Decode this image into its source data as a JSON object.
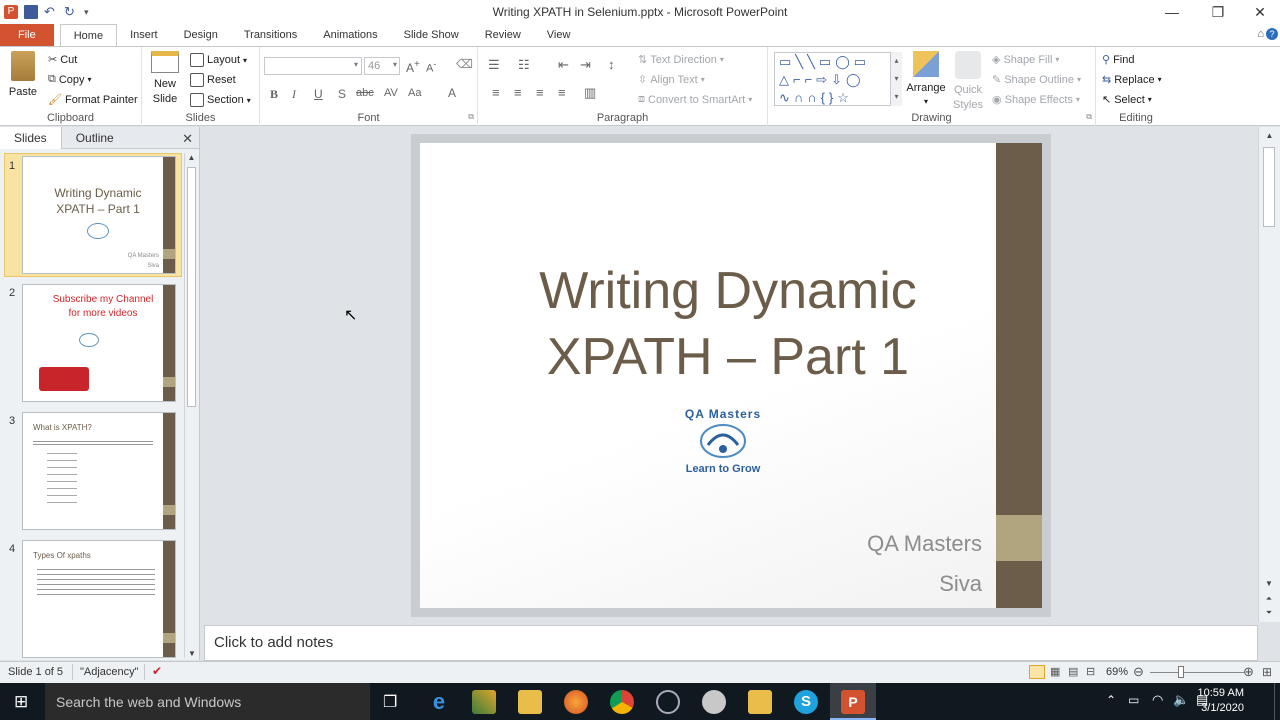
{
  "window": {
    "title": "Writing XPATH in Selenium.pptx - Microsoft PowerPoint",
    "minimize": "—",
    "maximize": "❐",
    "close": "✕"
  },
  "tabs": [
    "File",
    "Home",
    "Insert",
    "Design",
    "Transitions",
    "Animations",
    "Slide Show",
    "Review",
    "View"
  ],
  "ribbon": {
    "clipboard": {
      "label": "Clipboard",
      "paste": "Paste",
      "cut": "Cut",
      "copy": "Copy",
      "format_painter": "Format Painter"
    },
    "slides": {
      "label": "Slides",
      "new_slide_1": "New",
      "new_slide_2": "Slide",
      "layout": "Layout",
      "reset": "Reset",
      "section": "Section"
    },
    "font": {
      "label": "Font",
      "font_name": "",
      "font_size": "46"
    },
    "paragraph": {
      "label": "Paragraph",
      "text_direction": "Text Direction",
      "align_text": "Align Text",
      "convert_smartart": "Convert to SmartArt"
    },
    "drawing": {
      "label": "Drawing",
      "arrange": "Arrange",
      "quick_styles_1": "Quick",
      "quick_styles_2": "Styles",
      "shape_fill": "Shape Fill",
      "shape_outline": "Shape Outline",
      "shape_effects": "Shape Effects"
    },
    "editing": {
      "label": "Editing",
      "find": "Find",
      "replace": "Replace",
      "select": "Select"
    }
  },
  "slides_panel": {
    "tab_slides": "Slides",
    "tab_outline": "Outline",
    "thumbnails": [
      {
        "num": "1",
        "title": "Writing Dynamic XPATH – Part 1",
        "footer1": "QA Masters",
        "footer2": "Siva"
      },
      {
        "num": "2",
        "title": "Subscribe  my Channel for more videos"
      },
      {
        "num": "3",
        "title": "What is XPATH?"
      },
      {
        "num": "4",
        "title": "Types Of xpaths"
      }
    ]
  },
  "slide": {
    "title": "Writing Dynamic XPATH – Part 1",
    "logo_text": "QA Masters",
    "logo_tagline": "Learn to Grow",
    "subtitle_1": "QA Masters",
    "subtitle_2": "Siva"
  },
  "notes": {
    "placeholder": "Click to add notes"
  },
  "status": {
    "slide_info": "Slide 1 of 5",
    "theme": "\"Adjacency\"",
    "zoom": "69%"
  },
  "taskbar": {
    "search_placeholder": "Search the web and Windows",
    "time": "10:59 AM",
    "date": "3/1/2020"
  },
  "colors": {
    "accent_brown": "#6b5d4a",
    "accent_tan": "#b1a57f",
    "file_tab": "#d35230"
  }
}
